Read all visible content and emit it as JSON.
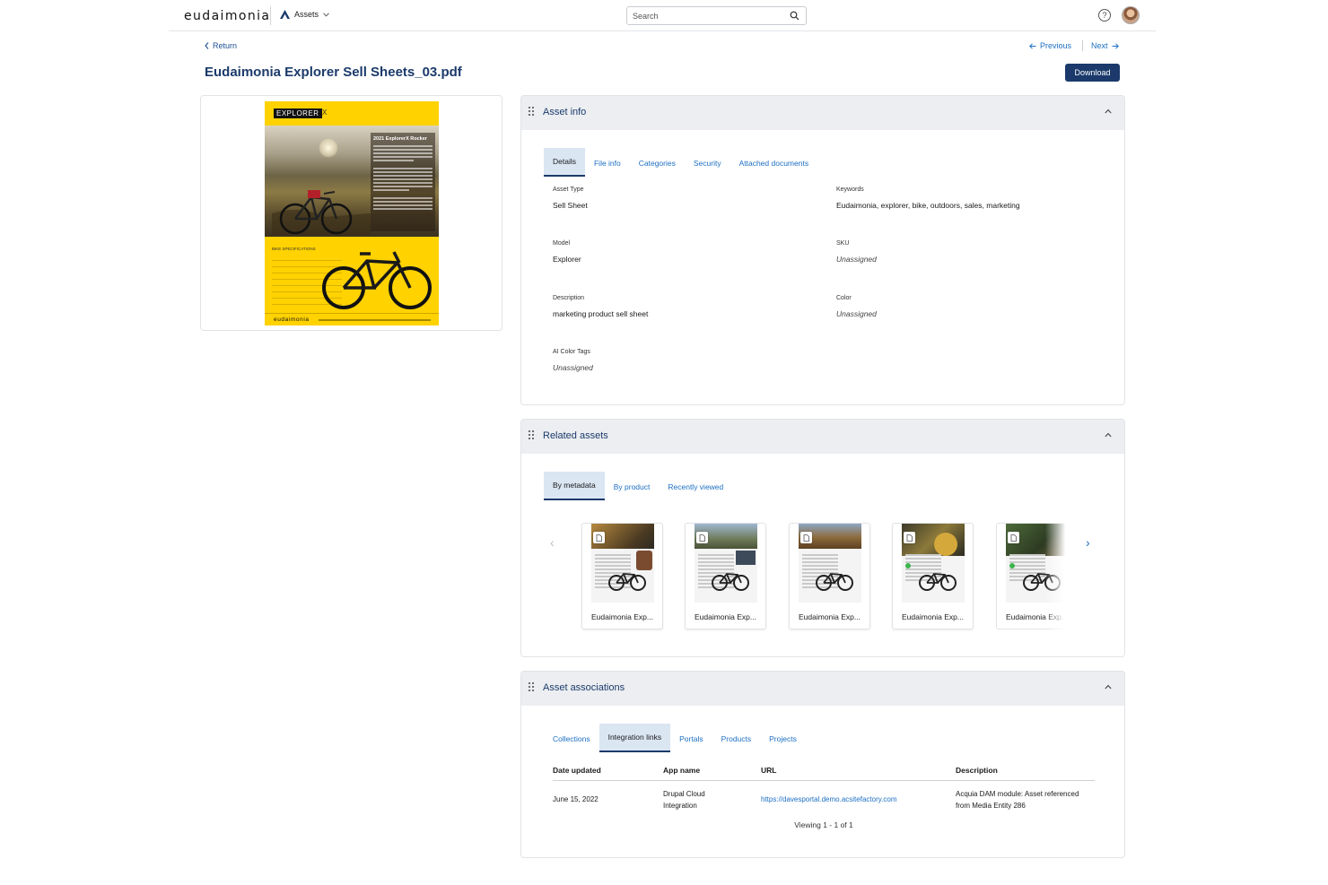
{
  "topbar": {
    "logo": "eudaimonia",
    "app_switch_label": "Assets",
    "search_placeholder": "Search",
    "help_glyph": "?"
  },
  "nav": {
    "return_label": "Return",
    "previous_label": "Previous",
    "next_label": "Next"
  },
  "page": {
    "title": "Eudaimonia Explorer Sell Sheets_03.pdf",
    "download_label": "Download"
  },
  "preview": {
    "brand": "EXPLORER",
    "brand_suffix": "X",
    "headline": "2021 ExplorerX Rocker",
    "spec_heading": "BIKE SPECIFICATIONS",
    "footer_logo": "eudaimonia",
    "colors": {
      "sheet": "#ffd200"
    }
  },
  "asset_info": {
    "title": "Asset info",
    "tabs": [
      {
        "label": "Details",
        "active": true
      },
      {
        "label": "File info"
      },
      {
        "label": "Categories"
      },
      {
        "label": "Security"
      },
      {
        "label": "Attached documents"
      }
    ],
    "fields": {
      "asset_type": {
        "label": "Asset Type",
        "value": "Sell Sheet"
      },
      "keywords": {
        "label": "Keywords",
        "value": "Eudaimonia, explorer, bike, outdoors, sales, marketing"
      },
      "model": {
        "label": "Model",
        "value": "Explorer"
      },
      "sku": {
        "label": "SKU",
        "value": "Unassigned"
      },
      "description": {
        "label": "Description",
        "value": "marketing product sell sheet"
      },
      "color": {
        "label": "Color",
        "value": "Unassigned"
      },
      "ai_color_tags": {
        "label": "AI Color Tags",
        "value": "Unassigned"
      }
    }
  },
  "related_assets": {
    "title": "Related assets",
    "tabs": [
      {
        "label": "By metadata",
        "active": true
      },
      {
        "label": "By product"
      },
      {
        "label": "Recently viewed"
      }
    ],
    "items": [
      {
        "name": "Eudaimonia Exp..."
      },
      {
        "name": "Eudaimonia Exp..."
      },
      {
        "name": "Eudaimonia Exp..."
      },
      {
        "name": "Eudaimonia Exp..."
      },
      {
        "name": "Eudaimonia Exp..."
      }
    ]
  },
  "associations": {
    "title": "Asset associations",
    "tabs": [
      {
        "label": "Collections"
      },
      {
        "label": "Integration links",
        "active": true
      },
      {
        "label": "Portals"
      },
      {
        "label": "Products"
      },
      {
        "label": "Projects"
      }
    ],
    "columns": [
      "Date updated",
      "App name",
      "URL",
      "Description"
    ],
    "rows": [
      {
        "date": "June 15, 2022",
        "app_line1": "Drupal Cloud",
        "app_line2": "Integration",
        "url": "https://davesportal.demo.acsitefactory.com",
        "desc_line1": "Acquia DAM module: Asset referenced",
        "desc_line2": "from Media Entity 286"
      }
    ],
    "viewing": "Viewing 1 - 1 of 1"
  },
  "colors": {
    "primary": "#1b3a6b",
    "link": "#1d6fc2",
    "panel_header": "#eceef1",
    "active_tab": "#dbe6f3"
  }
}
